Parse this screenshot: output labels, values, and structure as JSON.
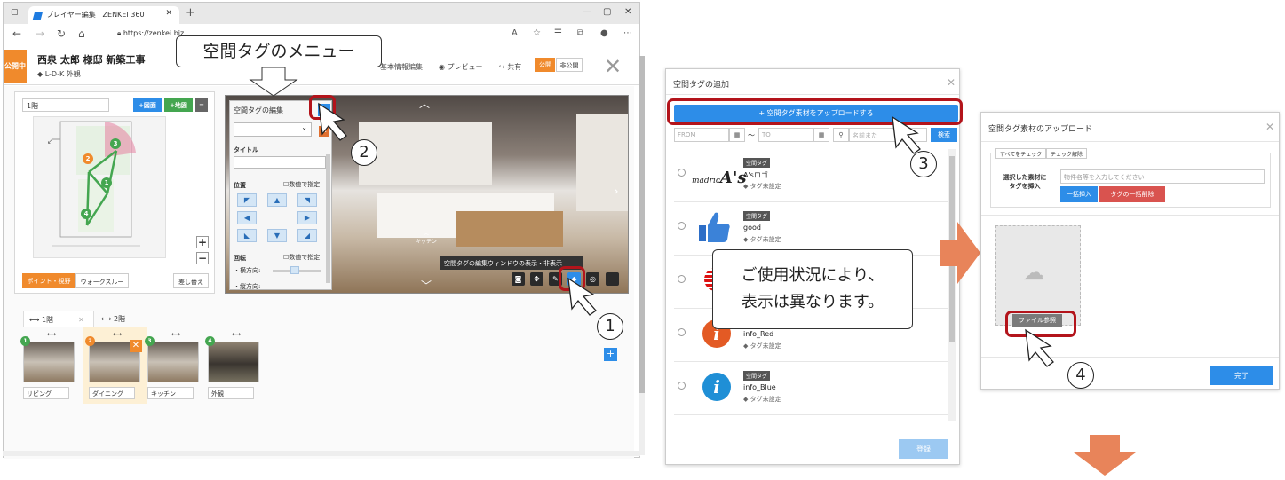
{
  "browser": {
    "tab_title": "プレイヤー編集 | ZENKEI 360",
    "url": "https://zenkei.biz"
  },
  "header": {
    "badge": "公開中",
    "title": "西泉 太郎 様邸 新築工事",
    "tag": "L-D-K 外観",
    "links": [
      "基本情報編集",
      "プレビュー",
      "共有"
    ],
    "public": "公開",
    "private": "非公開"
  },
  "plan": {
    "floor": "1階",
    "btn_plan": "+図面",
    "btn_map": "+地図",
    "mode1": "ポイント・視野",
    "mode2": "ウォークスルー",
    "replace": "差し替え",
    "nodes": [
      "3",
      "2",
      "1",
      "4"
    ]
  },
  "tag_panel": {
    "title": "空間タグの編集",
    "title_label": "タイトル",
    "position": "位置",
    "numeric": "数値で指定",
    "rotation": "回転",
    "yaw": "・横方向:",
    "pitch": "・縦方向:"
  },
  "viewer": {
    "tooltip": "空間タグの編集ウィンドウの表示・非表示",
    "kitchen": "キッチン"
  },
  "floors": {
    "tabs": [
      "1階",
      "2階"
    ],
    "thumbs": [
      {
        "num": "1",
        "label": "リビング",
        "color": "#44a650"
      },
      {
        "num": "2",
        "label": "ダイニング",
        "color": "#f08a2c"
      },
      {
        "num": "3",
        "label": "キッチン",
        "color": "#44a650"
      },
      {
        "num": "4",
        "label": "外観",
        "color": "#44a650"
      }
    ]
  },
  "callouts": {
    "menu": "空間タグのメニュー",
    "note_line1": "ご使用状況により、",
    "note_line2": "表示は異なります。",
    "n1": "1",
    "n2": "2",
    "n3": "3",
    "n4": "4"
  },
  "modal1": {
    "title": "空間タグの追加",
    "upload": "空間タグ素材をアップロードする",
    "from": "FROM",
    "to": "TO",
    "tilde": "〜",
    "name_ph": "名前また",
    "search": "検索",
    "badge": "空間タグ",
    "untagged": "タグ未設定",
    "items": [
      "A'sロゴ",
      "good",
      "info_Red",
      "info_Blue",
      ""
    ],
    "register": "登録"
  },
  "modal2": {
    "title": "空間タグ素材のアップロード",
    "check_all": "すべてをチェック",
    "uncheck": "チェック解除",
    "selected_l1": "選択した素材に",
    "selected_l2": "タグを挿入",
    "input_ph": "物件名等を入力してください",
    "bulk_insert": "一括挿入",
    "bulk_delete": "タグの一括削除",
    "file_btn": "ファイル参照",
    "done": "完了"
  },
  "colors": {
    "accent": "#2d8de8",
    "orange": "#f08a2c",
    "green": "#44a650",
    "red": "#b3141b",
    "arrow": "#e8845a"
  }
}
